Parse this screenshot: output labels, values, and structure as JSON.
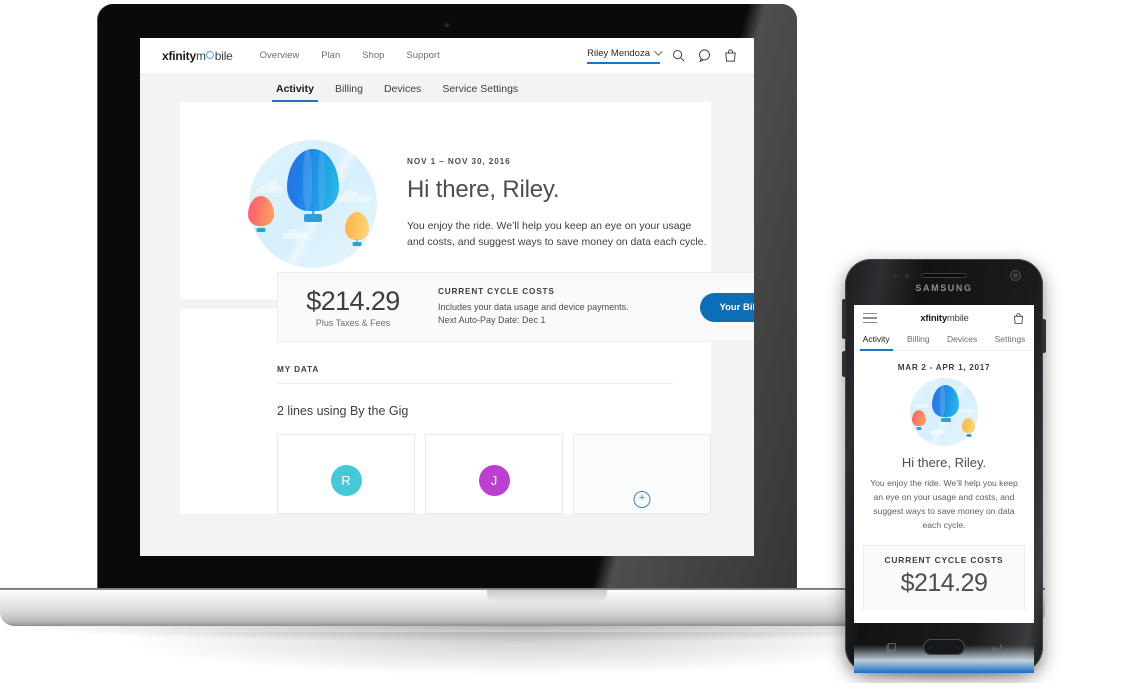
{
  "desktop": {
    "brand": {
      "part1": "xfinity",
      "part2": "m",
      "part3": "bile"
    },
    "nav": [
      {
        "label": "Overview"
      },
      {
        "label": "Plan"
      },
      {
        "label": "Shop"
      },
      {
        "label": "Support"
      }
    ],
    "account": {
      "name": "Riley Mendoza",
      "chevron": "chevron-down-icon"
    },
    "header_icons": [
      {
        "name": "search-icon"
      },
      {
        "name": "chat-bubble-icon"
      },
      {
        "name": "shopping-bag-icon"
      }
    ],
    "tabs": [
      {
        "label": "Activity",
        "active": true
      },
      {
        "label": "Billing",
        "active": false
      },
      {
        "label": "Devices",
        "active": false
      },
      {
        "label": "Service Settings",
        "active": false
      }
    ],
    "hero": {
      "cycle_range": "NOV 1 – NOV 30, 2016",
      "greeting": "Hi there, Riley.",
      "body": "You enjoy the ride. We’ll help you keep an eye on your usage and costs, and suggest ways to save money on data each cycle.",
      "illustration": "hot-air-balloons-illustration"
    },
    "cost_card": {
      "amount": "$214.29",
      "amount_sub": "Plus Taxes & Fees",
      "label": "CURRENT CYCLE COSTS",
      "line1": "Includes your data usage and device payments.",
      "line2": "Next Auto-Pay Date: Dec 1",
      "button": "Your Bill So Far"
    },
    "my_data": {
      "section_label": "MY DATA",
      "summary": "2 lines using By the Gig",
      "lines": [
        {
          "initial": "R",
          "color": "#45c8d8"
        },
        {
          "initial": "J",
          "color": "#bd3fd1"
        }
      ],
      "add_line": {
        "icon": "plus-circle-icon",
        "color": "#3d86c2"
      }
    }
  },
  "phone": {
    "device_brand": "SAMSUNG",
    "brand": {
      "part1": "xfinity",
      "part2": "m",
      "part3": "bile"
    },
    "menu_icon": "hamburger-menu-icon",
    "bag_icon": "shopping-bag-icon",
    "tabs": [
      {
        "label": "Activity",
        "active": true
      },
      {
        "label": "Billing",
        "active": false
      },
      {
        "label": "Devices",
        "active": false
      },
      {
        "label": "Settings",
        "active": false
      }
    ],
    "cycle_range": "MAR 2 - APR 1, 2017",
    "greeting": "Hi there, Riley.",
    "body": "You enjoy the ride. We’ll help you keep an eye on your usage and costs, and suggest ways to save money on data each cycle.",
    "cost": {
      "label": "CURRENT CYCLE COSTS",
      "amount": "$214.29"
    },
    "nav_buttons": [
      {
        "name": "recents-button"
      },
      {
        "name": "home-button"
      },
      {
        "name": "back-button"
      }
    ]
  },
  "theme": {
    "accent_blue": "#1f74c4",
    "button_blue": "#0d6eb8",
    "page_bg": "#f2f3f5",
    "text_dark": "#3c4043",
    "text_muted": "#6b6f73"
  }
}
